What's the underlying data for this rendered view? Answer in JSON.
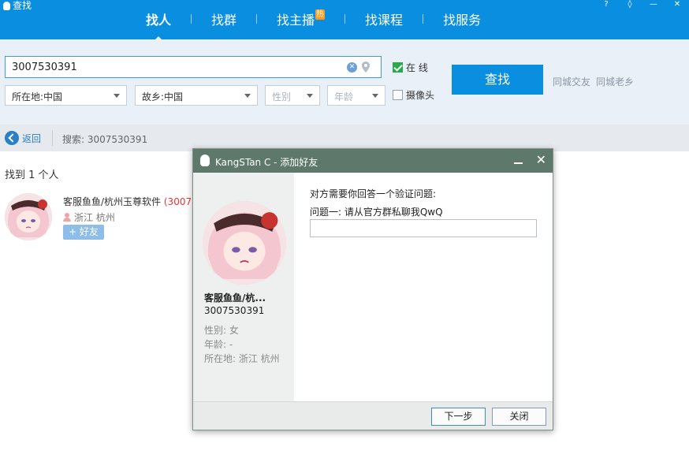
{
  "window": {
    "title": "查找",
    "controls": [
      "?",
      "◊",
      "—",
      "✕"
    ]
  },
  "tabs": [
    {
      "label": "找人",
      "active": true
    },
    {
      "label": "找群"
    },
    {
      "label": "找主播",
      "badge": "热"
    },
    {
      "label": "找课程"
    },
    {
      "label": "找服务"
    }
  ],
  "search": {
    "value": "3007530391",
    "location": "所在地:中国",
    "hometown": "故乡:中国",
    "gender_placeholder": "性别",
    "age_placeholder": "年龄",
    "online_label": "在  线",
    "online_checked": true,
    "camera_label": "摄像头",
    "camera_checked": false,
    "find_button": "查找",
    "quick_links": [
      "同城交友",
      "同城老乡"
    ]
  },
  "results_bar": {
    "back_label": "返回",
    "search_label": "搜索:   3007530391"
  },
  "results": {
    "count_text": "找到 1 个人",
    "items": [
      {
        "name": "客服鱼鱼/杭州玉尊软件",
        "uid": "(3007",
        "location": "浙江  杭州",
        "add_label": "+ 好友"
      }
    ]
  },
  "dialog": {
    "title": "KangSTan C - 添加好友",
    "profile": {
      "name": "客服鱼鱼/杭...",
      "uid": "3007530391",
      "gender": "性别: 女",
      "age": "年龄:   -",
      "location": "所在地: 浙江  杭州"
    },
    "prompt": "对方需要你回答一个验证问题:",
    "question": "问题一: 请从官方群私聊我QwQ",
    "answer": "",
    "next_button": "下一步",
    "close_button": "关闭"
  },
  "colors": {
    "accent": "#0a8fe0",
    "dialog_title": "#5e796b",
    "uid_red": "#e33333",
    "hot_badge": "#ff9a16"
  }
}
